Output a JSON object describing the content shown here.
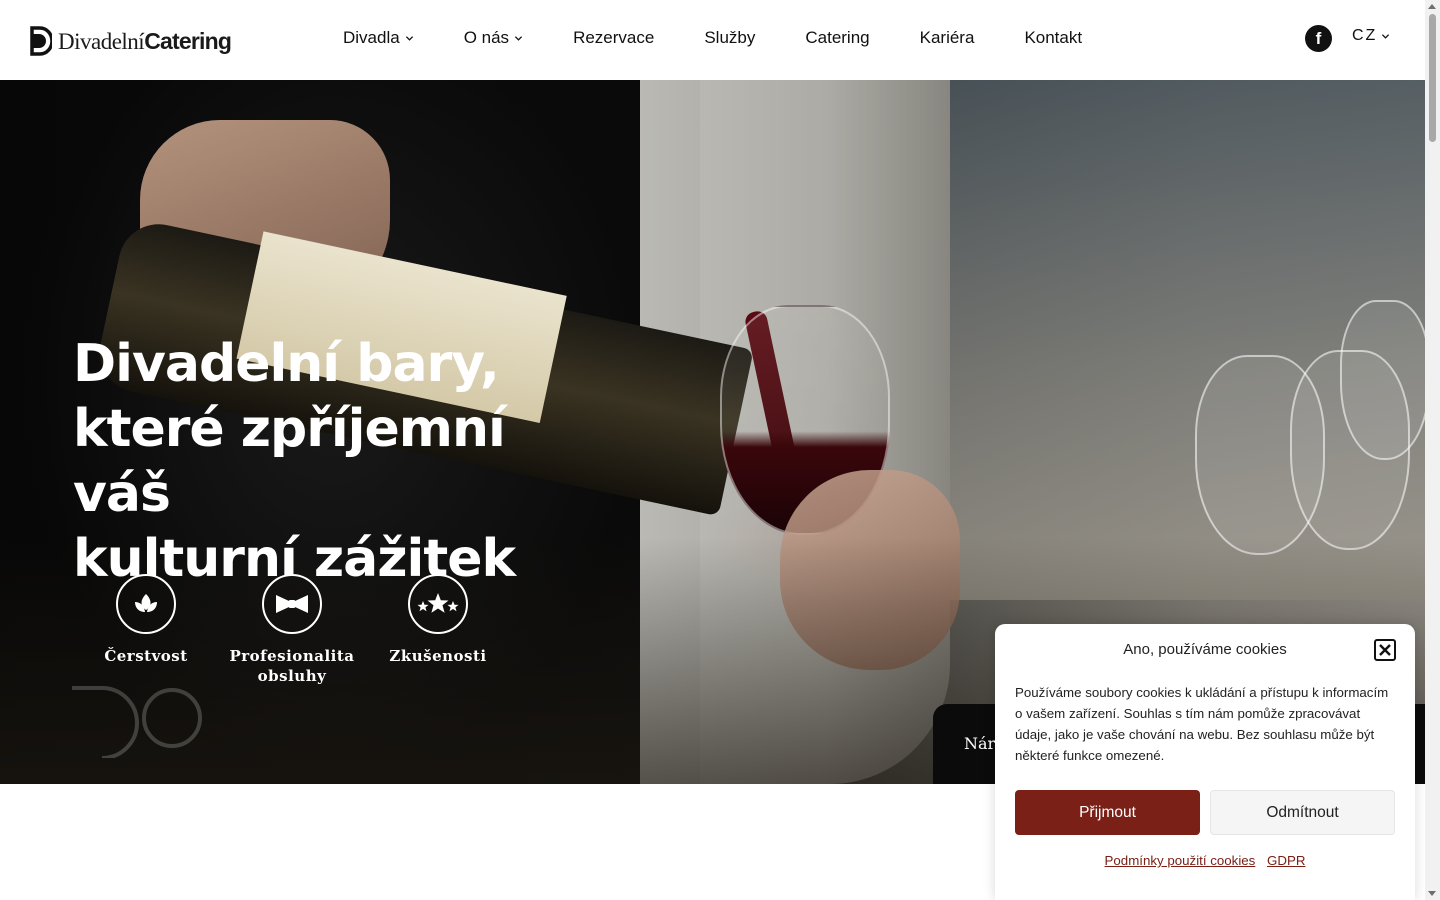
{
  "header": {
    "logo": {
      "light": "Divadelní",
      "bold": "Catering"
    },
    "nav": [
      {
        "label": "Divadla",
        "dropdown": true
      },
      {
        "label": "O nás",
        "dropdown": true
      },
      {
        "label": "Rezervace",
        "dropdown": false
      },
      {
        "label": "Služby",
        "dropdown": false
      },
      {
        "label": "Catering",
        "dropdown": false
      },
      {
        "label": "Kariéra",
        "dropdown": false
      },
      {
        "label": "Kontakt",
        "dropdown": false
      }
    ],
    "social_icon": "facebook-icon",
    "language": "CZ"
  },
  "hero": {
    "title_lines": [
      "Divadelní bary,",
      "které zpříjemní váš",
      "kulturní zážitek"
    ],
    "features": [
      {
        "label": "Čerstvost",
        "icon": "leaf-icon"
      },
      {
        "label": "Profesionalita obsluhy",
        "icon": "bowtie-icon"
      },
      {
        "label": "Zkušenosti",
        "icon": "stars-icon"
      }
    ],
    "bottom_box_text": "Náro"
  },
  "cookie": {
    "title": "Ano, používáme cookies",
    "text": "Používáme soubory cookies k ukládání a přístupu k informacím o vašem zařízení. Souhlas s tím nám pomůže zpracovávat údaje, jako je vaše chování na webu. Bez souhlasu může být některé funkce omezené.",
    "accept_label": "Přijmout",
    "decline_label": "Odmítnout",
    "links": [
      "Podmínky použití cookies",
      "GDPR"
    ]
  },
  "colors": {
    "accent": "#7a2016",
    "header_bg": "#ffffff",
    "hero_text": "#ffffff"
  }
}
